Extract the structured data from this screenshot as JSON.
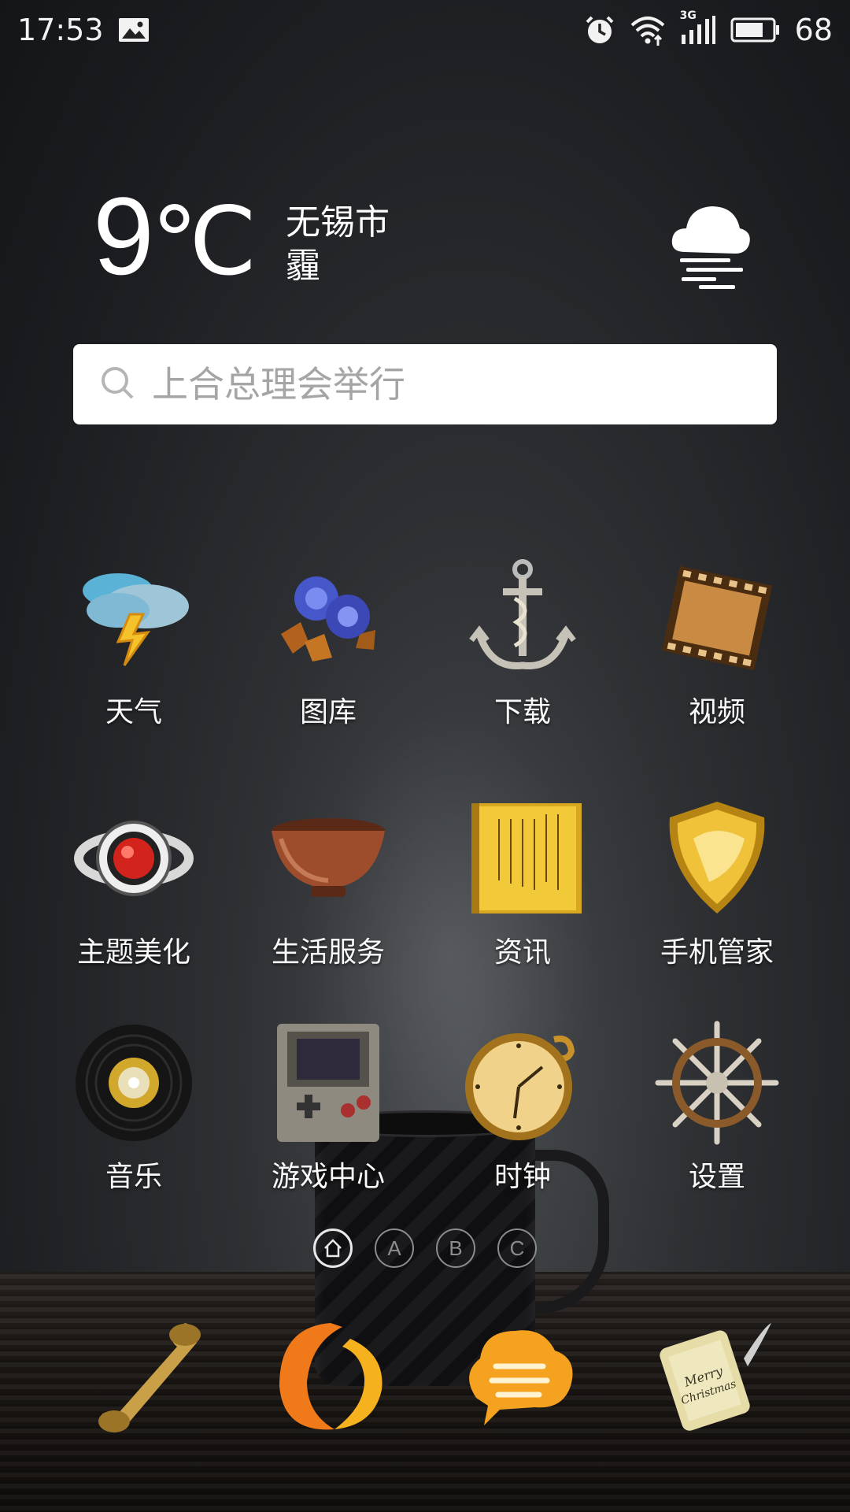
{
  "status_bar": {
    "time": "17:53",
    "battery_level": "68",
    "network": "3G",
    "icons": [
      "image-icon",
      "alarm-icon",
      "wifi-icon",
      "signal-icon",
      "battery-icon"
    ]
  },
  "weather": {
    "temperature": "9",
    "unit": "℃",
    "city": "无锡市",
    "condition": "霾",
    "icon": "haze-cloud-icon"
  },
  "search": {
    "placeholder": "上合总理会举行"
  },
  "apps": [
    {
      "label": "天气",
      "icon": "weather-storm-icon"
    },
    {
      "label": "图库",
      "icon": "gallery-roses-icon"
    },
    {
      "label": "下载",
      "icon": "anchor-icon"
    },
    {
      "label": "视频",
      "icon": "film-icon"
    },
    {
      "label": "主题美化",
      "icon": "ring-icon"
    },
    {
      "label": "生活服务",
      "icon": "bowl-icon"
    },
    {
      "label": "资讯",
      "icon": "book-icon"
    },
    {
      "label": "手机管家",
      "icon": "shield-icon"
    },
    {
      "label": "音乐",
      "icon": "vinyl-icon"
    },
    {
      "label": "游戏中心",
      "icon": "gameboy-icon"
    },
    {
      "label": "时钟",
      "icon": "pocket-watch-icon"
    },
    {
      "label": "设置",
      "icon": "ship-wheel-icon"
    }
  ],
  "pager": {
    "pages": [
      "",
      "A",
      "B",
      "C"
    ],
    "active_index": 0
  },
  "dock": [
    {
      "icon": "phone-receiver-icon"
    },
    {
      "icon": "browser-icon"
    },
    {
      "icon": "messages-icon"
    },
    {
      "icon": "notes-letter-icon",
      "text": "Merry Christmas"
    }
  ]
}
